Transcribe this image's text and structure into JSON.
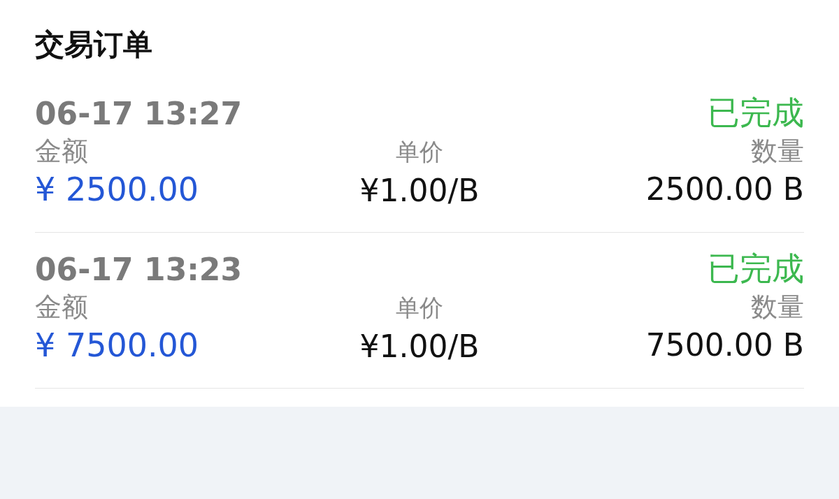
{
  "title": "交易订单",
  "orders": [
    {
      "time": "06-17 13:27",
      "status": "已完成",
      "amount_label": "金额",
      "amount": "¥ 2500.00",
      "price_label": "单价",
      "price": "¥1.00/B",
      "quantity_label": "数量",
      "quantity": "2500.00 B"
    },
    {
      "time": "06-17 13:23",
      "status": "已完成",
      "amount_label": "金额",
      "amount": "¥ 7500.00",
      "price_label": "单价",
      "price": "¥1.00/B",
      "quantity_label": "数量",
      "quantity": "7500.00 B"
    }
  ]
}
